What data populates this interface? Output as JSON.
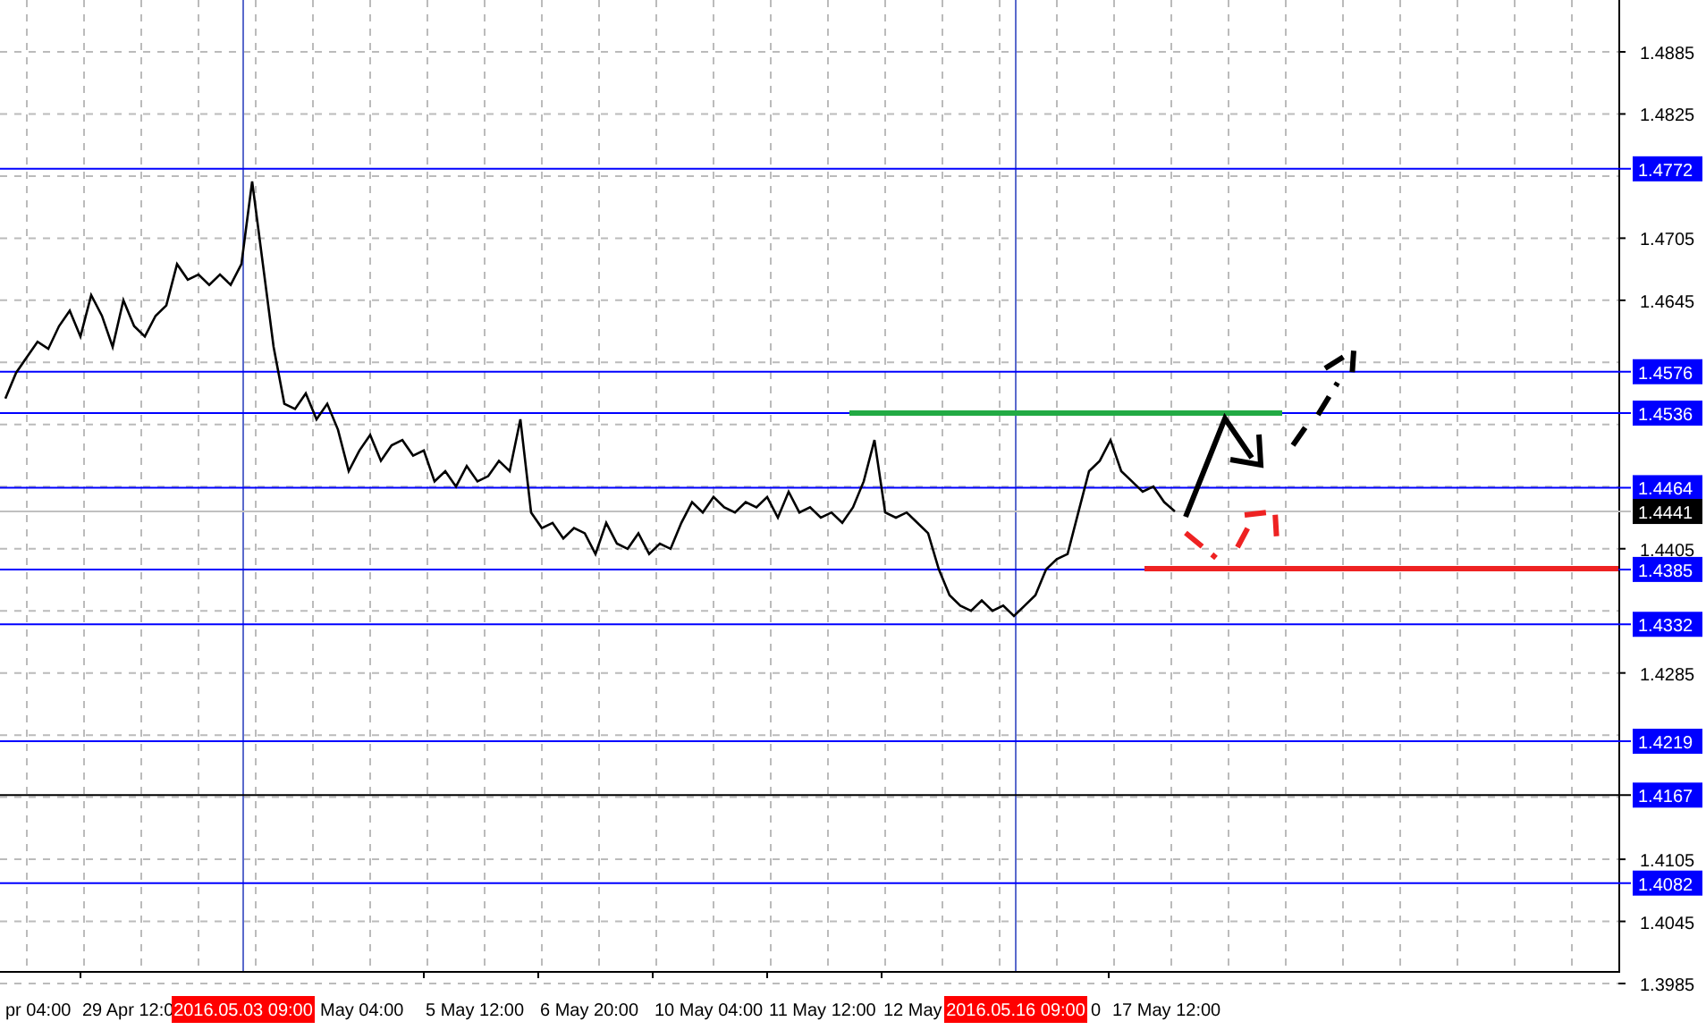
{
  "chart": {
    "chart_data": {
      "type": "line",
      "grid": true,
      "ylim": [
        1.3985,
        1.4885
      ],
      "yticks": [
        1.4885,
        1.4825,
        1.4705,
        1.4645,
        1.4405,
        1.4285,
        1.4105,
        1.4045,
        1.3985
      ],
      "series": [
        {
          "color": "#000000",
          "values": [
            1.455,
            1.4575,
            1.459,
            1.4605,
            1.4598,
            1.462,
            1.4635,
            1.461,
            1.465,
            1.463,
            1.46,
            1.4645,
            1.462,
            1.461,
            1.463,
            1.464,
            1.468,
            1.4665,
            1.467,
            1.466,
            1.467,
            1.466,
            1.468,
            1.476,
            1.468,
            1.46,
            1.4545,
            1.454,
            1.4555,
            1.453,
            1.4545,
            1.452,
            1.448,
            1.45,
            1.4515,
            1.449,
            1.4505,
            1.451,
            1.4495,
            1.45,
            1.447,
            1.448,
            1.4465,
            1.4485,
            1.447,
            1.4475,
            1.449,
            1.448,
            1.453,
            1.444,
            1.4425,
            1.443,
            1.4415,
            1.4425,
            1.442,
            1.44,
            1.443,
            1.441,
            1.4405,
            1.442,
            1.44,
            1.441,
            1.4405,
            1.443,
            1.445,
            1.444,
            1.4455,
            1.4445,
            1.444,
            1.445,
            1.4445,
            1.4455,
            1.4435,
            1.446,
            1.444,
            1.4445,
            1.4435,
            1.444,
            1.443,
            1.4445,
            1.447,
            1.451,
            1.444,
            1.4435,
            1.444,
            1.443,
            1.442,
            1.4385,
            1.436,
            1.435,
            1.4345,
            1.4355,
            1.4345,
            1.435,
            1.434,
            1.435,
            1.436,
            1.4385,
            1.4395,
            1.44,
            1.444,
            1.448,
            1.449,
            1.451,
            1.448,
            1.447,
            1.446,
            1.4465,
            1.445,
            1.4441
          ]
        }
      ],
      "ref_lines": [
        {
          "axis": "y",
          "value": 1.4772,
          "label": "1.4772",
          "color": "#0000ff"
        },
        {
          "axis": "y",
          "value": 1.4576,
          "label": "1.4576",
          "color": "#0000ff"
        },
        {
          "axis": "y",
          "value": 1.4536,
          "label": "1.4536",
          "color": "#0000ff"
        },
        {
          "axis": "y",
          "value": 1.4464,
          "label": "1.4464",
          "color": "#0000ff"
        },
        {
          "axis": "y",
          "value": 1.4441,
          "label": "1.4441",
          "color": "#c0c0c0"
        },
        {
          "axis": "y",
          "value": 1.4385,
          "label": "1.4385",
          "color": "#0000ff"
        },
        {
          "axis": "y",
          "value": 1.4332,
          "label": "1.4332",
          "color": "#0000ff"
        },
        {
          "axis": "y",
          "value": 1.4219,
          "label": "1.4219",
          "color": "#0000ff"
        },
        {
          "axis": "y",
          "value": 1.4167,
          "label": "1.4167",
          "color": "#000000"
        },
        {
          "axis": "y",
          "value": 1.4082,
          "label": "1.4082",
          "color": "#0000ff"
        }
      ]
    },
    "x_axis_labels": [
      "pr 04:00",
      "29 Apr 12:0",
      "May 04:00",
      "5 May 12:00",
      "6 May 20:00",
      "10 May 04:00",
      "11 May 12:00",
      "12 May",
      "0",
      "17 May 12:00"
    ],
    "time_markers": [
      {
        "label": "2016.05.03 09:00"
      },
      {
        "label": "2016.05.16 09:00"
      }
    ]
  }
}
